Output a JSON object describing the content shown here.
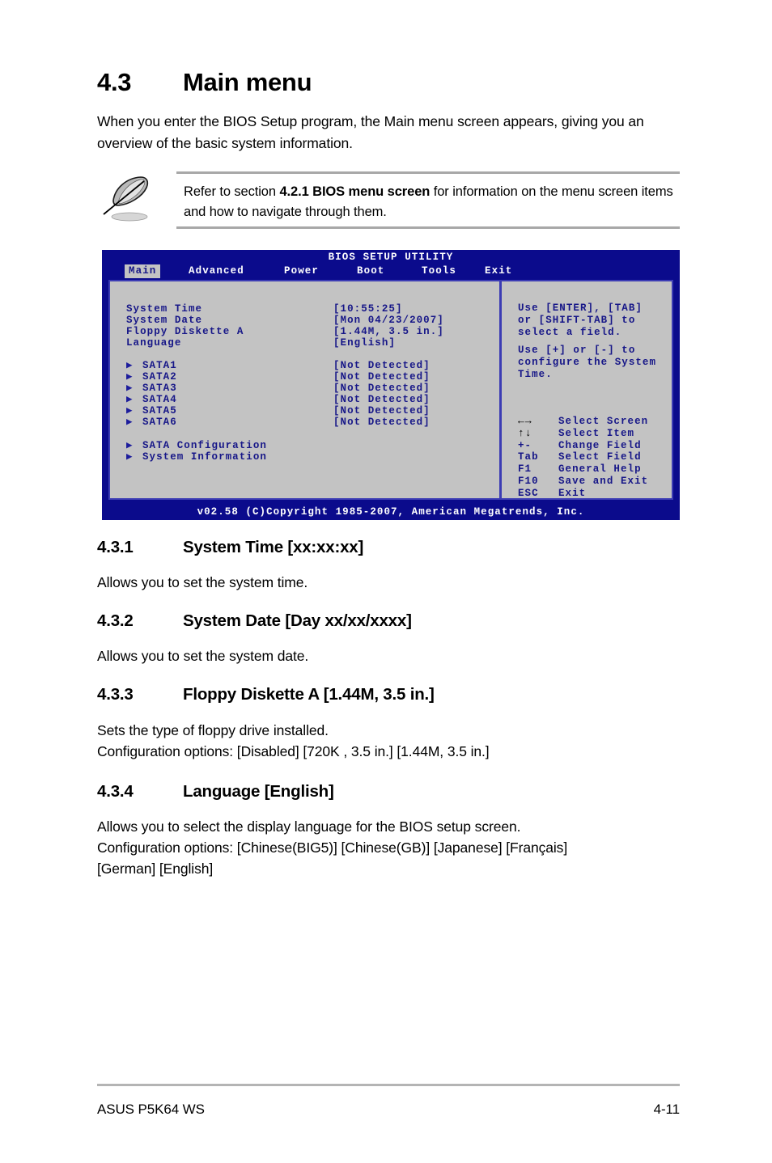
{
  "section": {
    "number": "4.3",
    "title": "Main menu",
    "intro": "When you enter the BIOS Setup program, the Main menu screen appears, giving you an overview of the basic system information."
  },
  "note": {
    "icon": "quill-pen-icon",
    "text_before": "Refer to section ",
    "text_bold": "4.2.1  BIOS menu screen",
    "text_after": " for information on the menu screen items and how to navigate through them."
  },
  "bios": {
    "title": "BIOS SETUP UTILITY",
    "tabs": [
      {
        "label": "Main",
        "active": true
      },
      {
        "label": "Advanced",
        "active": false
      },
      {
        "label": "Power",
        "active": false
      },
      {
        "label": "Boot",
        "active": false
      },
      {
        "label": "Tools",
        "active": false
      },
      {
        "label": "Exit",
        "active": false
      }
    ],
    "fields": [
      {
        "label": "System Time",
        "value": "[10:55:25]"
      },
      {
        "label": "System Date",
        "value": "[Mon 04/23/2007]"
      },
      {
        "label": "Floppy Diskette A",
        "value": "[1.44M, 3.5 in.]"
      },
      {
        "label": "Language",
        "value": "[English]"
      }
    ],
    "drives": [
      {
        "label": "SATA1",
        "value": "[Not Detected]"
      },
      {
        "label": "SATA2",
        "value": "[Not Detected]"
      },
      {
        "label": "SATA3",
        "value": "[Not Detected]"
      },
      {
        "label": "SATA4",
        "value": "[Not Detected]"
      },
      {
        "label": "SATA5",
        "value": "[Not Detected]"
      },
      {
        "label": "SATA6",
        "value": "[Not Detected]"
      }
    ],
    "submenus": [
      {
        "label": "SATA Configuration"
      },
      {
        "label": "System Information"
      }
    ],
    "help_1": "Use [ENTER], [TAB]\nor [SHIFT-TAB] to\nselect a field.",
    "help_2": "Use [+] or [-] to\nconfigure the System\nTime.",
    "keys": [
      {
        "key": "←→",
        "glyph": true,
        "action": "Select Screen"
      },
      {
        "key": "↑↓",
        "glyph": true,
        "action": "Select Item"
      },
      {
        "key": "+-",
        "glyph": false,
        "action": "Change Field"
      },
      {
        "key": "Tab",
        "glyph": false,
        "action": "Select Field"
      },
      {
        "key": "F1",
        "glyph": false,
        "action": "General Help"
      },
      {
        "key": "F10",
        "glyph": false,
        "action": "Save and Exit"
      },
      {
        "key": "ESC",
        "glyph": false,
        "action": "Exit"
      }
    ],
    "footer": "v02.58 (C)Copyright 1985-2007, American Megatrends, Inc.",
    "colors": {
      "screen_blue": "#0b0b8c",
      "panel_gray": "#c3c3c3",
      "border_blue": "#3c3cb4",
      "text_blue": "#171788"
    }
  },
  "subsections": [
    {
      "number": "4.3.1",
      "title": "System Time [xx:xx:xx]",
      "body": "Allows you to set the system time."
    },
    {
      "number": "4.3.2",
      "title": "System Date [Day xx/xx/xxxx]",
      "body": "Allows you to set the system date."
    },
    {
      "number": "4.3.3",
      "title": "Floppy Diskette A [1.44M, 3.5 in.]",
      "body": "Sets the type of floppy drive installed.\nConfiguration options: [Disabled] [720K , 3.5 in.] [1.44M, 3.5 in.]"
    },
    {
      "number": "4.3.4",
      "title": "Language [English]",
      "body": "Allows you to select the display language for the BIOS setup screen.\nConfiguration options: [Chinese(BIG5)] [Chinese(GB)] [Japanese] [Français]\n[German] [English]"
    }
  ],
  "footer": {
    "product": "ASUS P5K64 WS",
    "page": "4-11"
  }
}
